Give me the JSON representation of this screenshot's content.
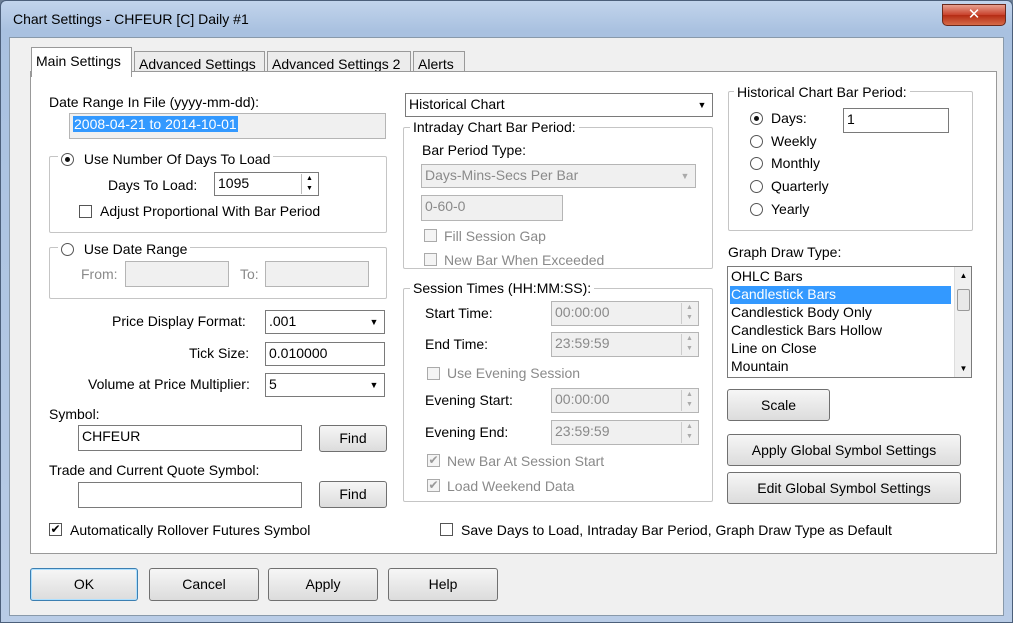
{
  "window": {
    "title": "Chart Settings - CHFEUR [C]  Daily  #1",
    "close_label": "✕"
  },
  "tabs": [
    {
      "label": "Main Settings"
    },
    {
      "label": "Advanced Settings"
    },
    {
      "label": "Advanced Settings 2"
    },
    {
      "label": "Alerts"
    }
  ],
  "date_range_in_file": {
    "label": "Date Range In File (yyyy-mm-dd):",
    "value": "2008-04-21 to 2014-10-01"
  },
  "days_to_load_group": {
    "radio_label": "Use Number Of Days To Load",
    "days_label": "Days To Load:",
    "days_value": "1095",
    "adjust_label": "Adjust Proportional With Bar Period"
  },
  "date_range_group": {
    "radio_label": "Use Date Range",
    "from_label": "From:",
    "to_label": "To:"
  },
  "price_display_format": {
    "label": "Price Display Format:",
    "value": ".001"
  },
  "tick_size": {
    "label": "Tick Size:",
    "value": "0.010000"
  },
  "volume_multiplier": {
    "label": "Volume at Price Multiplier:",
    "value": "5"
  },
  "symbol": {
    "label": "Symbol:",
    "value": "CHFEUR",
    "find_label": "Find"
  },
  "trade_quote_symbol": {
    "label": "Trade and Current Quote Symbol:",
    "value": "",
    "find_label": "Find"
  },
  "auto_rollover": {
    "label": "Automatically Rollover Futures Symbol",
    "checked": true
  },
  "chart_type_select": {
    "value": "Historical Chart"
  },
  "intraday_bar_period": {
    "title": "Intraday Chart Bar Period:",
    "bar_period_type_label": "Bar Period Type:",
    "bar_period_type_value": "Days-Mins-Secs Per Bar",
    "bar_period_value": "0-60-0",
    "fill_session_gap_label": "Fill Session Gap",
    "new_bar_exceeded_label": "New Bar When Exceeded"
  },
  "session_times": {
    "title": "Session Times (HH:MM:SS):",
    "start_label": "Start Time:",
    "start_value": "00:00:00",
    "end_label": "End Time:",
    "end_value": "23:59:59",
    "use_evening_label": "Use Evening Session",
    "evening_start_label": "Evening Start:",
    "evening_start_value": "00:00:00",
    "evening_end_label": "Evening End:",
    "evening_end_value": "23:59:59",
    "new_bar_session_label": "New Bar At Session Start",
    "load_weekend_label": "Load Weekend Data"
  },
  "historical_bar_period": {
    "title": "Historical Chart Bar Period:",
    "options": [
      "Days:",
      "Weekly",
      "Monthly",
      "Quarterly",
      "Yearly"
    ],
    "days_value": "1"
  },
  "graph_draw_type": {
    "label": "Graph Draw Type:",
    "items": [
      "OHLC Bars",
      "Candlestick Bars",
      "Candlestick Body Only",
      "Candlestick Bars Hollow",
      "Line on Close",
      "Mountain"
    ],
    "selected": "Candlestick Bars"
  },
  "scale_button": "Scale",
  "apply_global_button": "Apply Global Symbol Settings",
  "edit_global_button": "Edit Global Symbol Settings",
  "save_default": {
    "label": "Save Days to Load, Intraday Bar Period, Graph Draw Type as Default",
    "checked": false
  },
  "footer_buttons": {
    "ok": "OK",
    "cancel": "Cancel",
    "apply": "Apply",
    "help": "Help"
  }
}
